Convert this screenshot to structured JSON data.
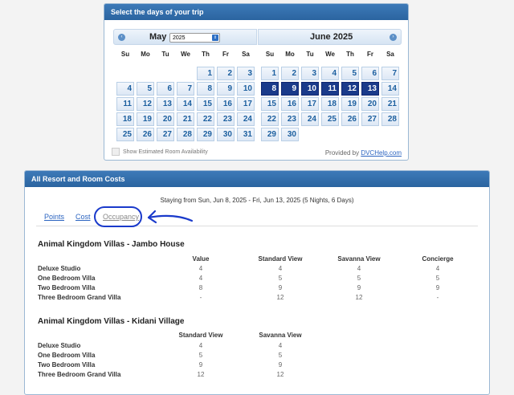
{
  "calendar": {
    "header": "Select the days of your trip",
    "left_month": {
      "name": "May",
      "year_value": "2025"
    },
    "right_month": {
      "name": "June 2025"
    },
    "weekdays": [
      "Su",
      "Mo",
      "Tu",
      "We",
      "Th",
      "Fr",
      "Sa"
    ],
    "may_days": [
      "1",
      "2",
      "3",
      "4",
      "5",
      "6",
      "7",
      "8",
      "9",
      "10",
      "11",
      "12",
      "13",
      "14",
      "15",
      "16",
      "17",
      "18",
      "19",
      "20",
      "21",
      "22",
      "23",
      "24",
      "25",
      "26",
      "27",
      "28",
      "29",
      "30",
      "31"
    ],
    "june_days": [
      "1",
      "2",
      "3",
      "4",
      "5",
      "6",
      "7",
      "8",
      "9",
      "10",
      "11",
      "12",
      "13",
      "14",
      "15",
      "16",
      "17",
      "18",
      "19",
      "20",
      "21",
      "22",
      "23",
      "24",
      "25",
      "26",
      "27",
      "28",
      "29",
      "30"
    ],
    "selected_june": [
      "8",
      "9",
      "10",
      "11",
      "12",
      "13"
    ],
    "availability_label": "Show Estimated Room Availability",
    "provided_prefix": "Provided by ",
    "provided_link": "DVCHelp.com",
    "nav_prev": "‹",
    "nav_next": "›",
    "select_arrow": "⇕",
    "colors": {
      "header": "#2b64a0",
      "selected": "#1a3a8a",
      "day_text": "#1c5f9f"
    }
  },
  "costs": {
    "header": "All Resort and Room Costs",
    "stay_text": "Staying from Sun, Jun 8, 2025 - Fri, Jun 13, 2025 (5 Nights, 6 Days)",
    "tabs": [
      "Points",
      "Cost",
      "Occupancy"
    ],
    "annotation_color": "#1a3acb",
    "resorts": [
      {
        "name": "Animal Kingdom Villas - Jambo House",
        "columns": [
          "Value",
          "Standard View",
          "Savanna View",
          "Concierge"
        ],
        "rows": [
          {
            "label": "Deluxe Studio",
            "values": [
              "4",
              "4",
              "4",
              "4"
            ]
          },
          {
            "label": "One Bedroom Villa",
            "values": [
              "4",
              "5",
              "5",
              "5"
            ]
          },
          {
            "label": "Two Bedroom Villa",
            "values": [
              "8",
              "9",
              "9",
              "9"
            ]
          },
          {
            "label": "Three Bedroom Grand Villa",
            "values": [
              "-",
              "12",
              "12",
              "-"
            ]
          }
        ]
      },
      {
        "name": "Animal Kingdom Villas - Kidani Village",
        "columns": [
          "Standard View",
          "Savanna View"
        ],
        "rows": [
          {
            "label": "Deluxe Studio",
            "values": [
              "4",
              "4"
            ]
          },
          {
            "label": "One Bedroom Villa",
            "values": [
              "5",
              "5"
            ]
          },
          {
            "label": "Two Bedroom Villa",
            "values": [
              "9",
              "9"
            ]
          },
          {
            "label": "Three Bedroom Grand Villa",
            "values": [
              "12",
              "12"
            ]
          }
        ]
      }
    ]
  }
}
